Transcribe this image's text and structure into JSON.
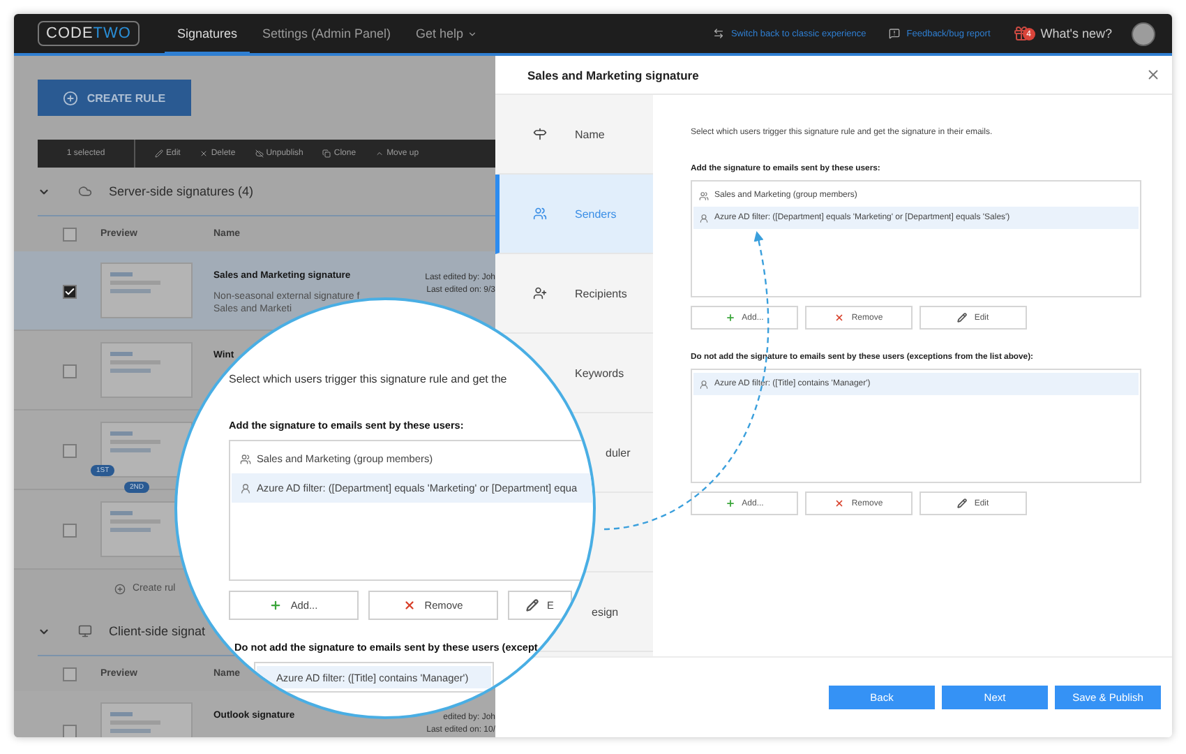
{
  "topbar": {
    "logo": {
      "part_1": "CODE",
      "part_2": "TWO"
    },
    "nav": [
      {
        "label": "Signatures",
        "selected": true,
        "kind": "plain"
      },
      {
        "label": "Settings (Admin Panel)",
        "selected": false,
        "kind": "plain"
      },
      {
        "label": "Get help",
        "selected": false,
        "kind": "dropdown"
      }
    ],
    "links": [
      {
        "label": "Switch back to classic experience",
        "kind": "switch"
      },
      {
        "label": "Feedback/bug report",
        "kind": "feedback"
      }
    ],
    "whats_new": {
      "label": "What's new?",
      "badge": "4"
    }
  },
  "list": {
    "create_button": "CREATE RULE",
    "toolbar": {
      "selection": "1 selected",
      "actions": [
        {
          "label": "Edit",
          "kind": "edit"
        },
        {
          "label": "Delete",
          "kind": "delete"
        },
        {
          "label": "Unpublish",
          "kind": "unpublish"
        },
        {
          "label": "Clone",
          "kind": "clone"
        },
        {
          "label": "Move up",
          "kind": "up"
        }
      ]
    },
    "sections": [
      {
        "title": "Server-side signatures (4)",
        "kind": "cloud",
        "expanded": true,
        "all_checked": false,
        "columns": [
          "Preview",
          "Name"
        ],
        "rows": [
          {
            "checked": true,
            "selected": true,
            "name": "Sales and Marketing signature",
            "description": [
              "Non-seasonal external signature f",
              "Sales and Marketi"
            ],
            "edited_by": "Last edited by: Joh",
            "edited_on": "Last edited on: 9/3"
          },
          {
            "checked": false,
            "selected": false,
            "name": "Wint"
          },
          {
            "checked": false,
            "selected": false,
            "badges": [
              "1ST",
              "2ND"
            ]
          },
          {
            "checked": false,
            "selected": false
          }
        ],
        "create_link": "Create rul"
      },
      {
        "title": "Client-side signat",
        "kind": "desktop",
        "expanded": true,
        "all_checked": false,
        "columns": [
          "Preview",
          "Name"
        ],
        "rows": [
          {
            "checked": false,
            "selected": false,
            "name": "Outlook signature",
            "edited_by": "edited by: Joh",
            "edited_on": "Last edited on: 10/"
          }
        ]
      }
    ]
  },
  "panel": {
    "title": "Sales and Marketing signature",
    "steps": [
      {
        "label": "Name",
        "kind": "name",
        "selected": false
      },
      {
        "label": "Senders",
        "kind": "senders",
        "selected": true
      },
      {
        "label": "Recipients",
        "kind": "recipients",
        "selected": false
      },
      {
        "label": "Keywords",
        "kind": "keywords",
        "selected": false
      },
      {
        "label": "duler",
        "kind": "scheduler",
        "selected": false
      },
      {
        "label": "esign",
        "kind": "design",
        "selected": false
      }
    ],
    "intro": "Select which users trigger this signature rule and get the signature in their emails.",
    "include": {
      "heading": "Add the signature to emails sent by these users:",
      "items": [
        {
          "label": "Sales and Marketing (group members)",
          "kind": "group",
          "selected": false
        },
        {
          "label": "Azure AD filter: ([Department] equals 'Marketing' or [Department] equals 'Sales')",
          "kind": "filter",
          "selected": true
        }
      ],
      "buttons": [
        {
          "label": "Add...",
          "kind": "add"
        },
        {
          "label": "Remove",
          "kind": "remove"
        },
        {
          "label": "Edit",
          "kind": "edit"
        }
      ]
    },
    "exclude": {
      "heading": "Do not add the signature to emails sent by these users (exceptions from the list above):",
      "items": [
        {
          "label": "Azure AD filter: ([Title] contains 'Manager')",
          "kind": "filter",
          "selected": true
        }
      ],
      "buttons": [
        {
          "label": "Add...",
          "kind": "add"
        },
        {
          "label": "Remove",
          "kind": "remove"
        },
        {
          "label": "Edit",
          "kind": "edit"
        }
      ]
    },
    "footer": [
      "Back",
      "Next",
      "Save & Publish"
    ]
  },
  "magnifier": {
    "intro": "Select which users trigger this signature rule and get the",
    "include": {
      "heading": "Add the signature to emails sent by these users:",
      "items": [
        {
          "label": "Sales and Marketing (group members)",
          "kind": "group",
          "selected": false
        },
        {
          "label": "Azure AD filter: ([Department] equals 'Marketing' or [Department] equa",
          "kind": "filter",
          "selected": true
        }
      ],
      "buttons": [
        {
          "label": "Add...",
          "kind": "add"
        },
        {
          "label": "Remove",
          "kind": "remove"
        },
        {
          "label": "E",
          "kind": "edit"
        }
      ]
    },
    "exclude": {
      "heading": "Do not add the signature to emails sent by these users (except",
      "items": [
        {
          "label": "Azure AD filter: ([Title] contains 'Manager')",
          "selected": true
        }
      ]
    }
  }
}
